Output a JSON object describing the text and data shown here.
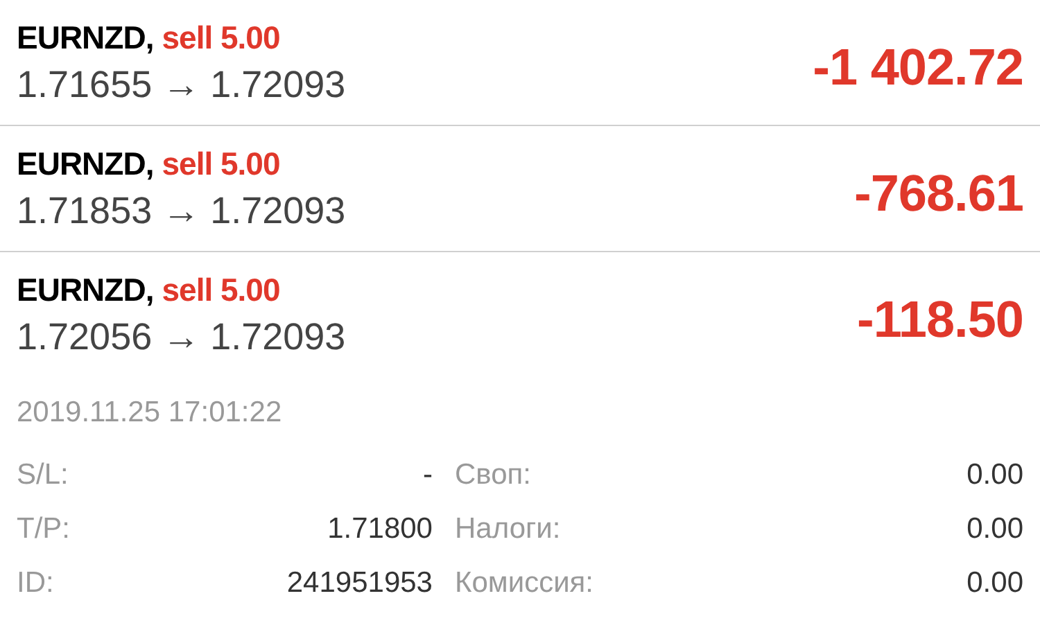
{
  "positions": [
    {
      "symbol": "EURNZD,",
      "trade": "sell 5.00",
      "prices": "1.71655 → 1.72093",
      "profit": "-1 402.72"
    },
    {
      "symbol": "EURNZD,",
      "trade": "sell 5.00",
      "prices": "1.71853 → 1.72093",
      "profit": "-768.61"
    },
    {
      "symbol": "EURNZD,",
      "trade": "sell 5.00",
      "prices": "1.72056 → 1.72093",
      "profit": "-118.50",
      "details": {
        "time": "2019.11.25 17:01:22",
        "rows": [
          {
            "label": "S/L:",
            "value": "-",
            "label_2": "Своп:",
            "value_2": "0.00"
          },
          {
            "label": "T/P:",
            "value": "1.71800",
            "label_2": "Налоги:",
            "value_2": "0.00"
          },
          {
            "label": "ID:",
            "value": "241951953",
            "label_2": "Комиссия:",
            "value_2": "0.00"
          }
        ]
      }
    }
  ]
}
